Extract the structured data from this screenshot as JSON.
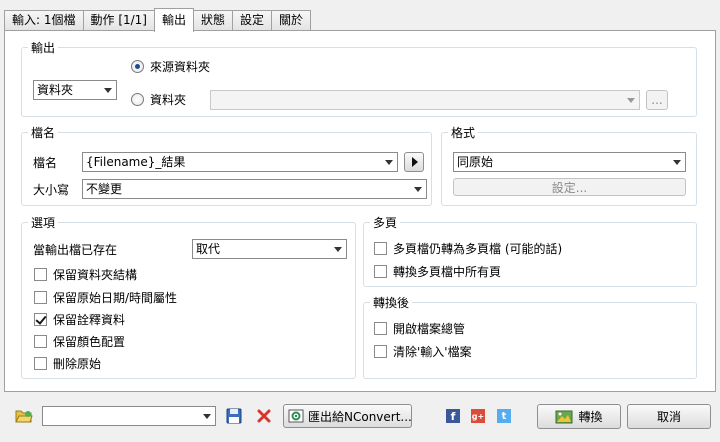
{
  "tabs": [
    {
      "label": "輸入: 1個檔",
      "active": false
    },
    {
      "label": "動作 [1/1]",
      "active": false
    },
    {
      "label": "輸出",
      "active": true
    },
    {
      "label": "狀態",
      "active": false
    },
    {
      "label": "設定",
      "active": false
    },
    {
      "label": "關於",
      "active": false
    }
  ],
  "output": {
    "title": "輸出",
    "mode_select": "資料夾",
    "radio_source": "來源資料夾",
    "radio_folder": "資料夾",
    "folder_path": "",
    "browse_label": "..."
  },
  "filename": {
    "title": "檔名",
    "name_label": "檔名",
    "name_value": "{Filename}_結果",
    "case_label": "大小寫",
    "case_value": "不變更"
  },
  "format": {
    "title": "格式",
    "value": "同原始",
    "settings_button": "設定..."
  },
  "options": {
    "title": "選項",
    "exists_label": "當輸出檔已存在",
    "exists_value": "取代",
    "items": [
      {
        "label": "保留資料夾結構",
        "checked": false
      },
      {
        "label": "保留原始日期/時間屬性",
        "checked": false
      },
      {
        "label": "保留詮釋資料",
        "checked": true
      },
      {
        "label": "保留顏色配置",
        "checked": false
      },
      {
        "label": "刪除原始",
        "checked": false
      }
    ]
  },
  "multipage": {
    "title": "多頁",
    "items": [
      {
        "label": "多頁檔仍轉為多頁檔 (可能的話)",
        "checked": false
      },
      {
        "label": "轉換多頁檔中所有頁",
        "checked": false
      }
    ]
  },
  "after": {
    "title": "轉換後",
    "items": [
      {
        "label": "開啟檔案總管",
        "checked": false
      },
      {
        "label": "清除'輸入'檔案",
        "checked": false
      }
    ]
  },
  "bottom": {
    "preset_value": "",
    "export_button": "匯出給NConvert...",
    "convert_button": "轉換",
    "cancel_button": "取消",
    "facebook_letter": "f",
    "gplus_letter": "g+",
    "twitter_letter": "t"
  },
  "colors": {
    "accent": "#1f4b8f",
    "delete": "#d9342b",
    "facebook": "#3b5998",
    "gplus": "#dd4b39",
    "twitter": "#55acee"
  }
}
